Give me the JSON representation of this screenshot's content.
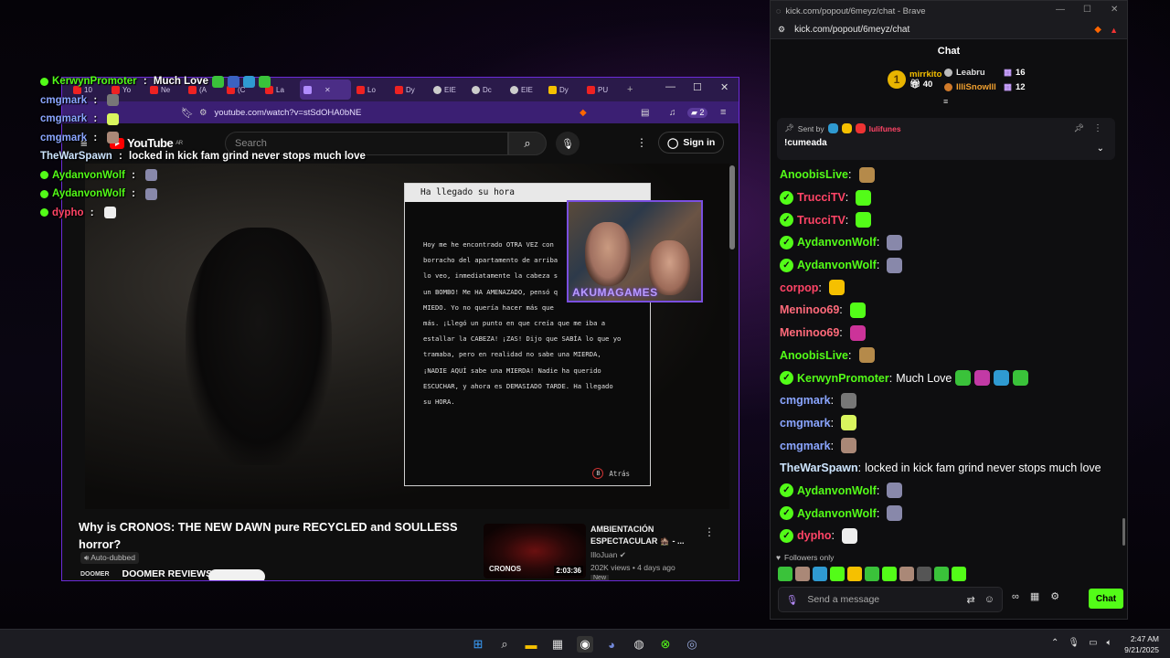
{
  "overlay_chat": [
    {
      "user": "KerwynPromoter",
      "sep": " : ",
      "text": "Much Love",
      "color": "#53fc18",
      "badge": true,
      "emotes": [
        "#3ac23a",
        "#3a62c2",
        "#2f9ad1",
        "#3ac23a"
      ]
    },
    {
      "user": "cmgmark",
      "sep": " : ",
      "text": "",
      "color": "#8aa5ff",
      "badge": false,
      "emotes": [
        "#777777"
      ]
    },
    {
      "user": "cmgmark",
      "sep": " : ",
      "text": "",
      "color": "#8aa5ff",
      "badge": false,
      "emotes": [
        "#d9f55e"
      ]
    },
    {
      "user": "cmgmark",
      "sep": " : ",
      "text": "",
      "color": "#8aa5ff",
      "badge": false,
      "emotes": [
        "#aa8877"
      ]
    },
    {
      "user": "TheWarSpawn",
      "sep": " : ",
      "text": "locked in kick fam grind never stops much love",
      "color": "#cde5ff",
      "badge": false,
      "emotes": []
    },
    {
      "user": "AydanvonWolf",
      "sep": " : ",
      "text": "",
      "color": "#53fc18",
      "badge": true,
      "emotes": [
        "#8888aa"
      ]
    },
    {
      "user": "AydanvonWolf",
      "sep": " : ",
      "text": "",
      "color": "#53fc18",
      "badge": true,
      "emotes": [
        "#8888aa"
      ]
    },
    {
      "user": "dypho",
      "sep": " : ",
      "text": "",
      "color": "#ff4466",
      "badge": true,
      "emotes": [
        "#eeeeee"
      ]
    }
  ],
  "youtube_browser": {
    "tabs": [
      {
        "label": "10",
        "fav": "red"
      },
      {
        "label": "Yo",
        "fav": "red"
      },
      {
        "label": "Ne",
        "fav": "red"
      },
      {
        "label": "(A",
        "fav": "red"
      },
      {
        "label": "(C",
        "fav": "red"
      },
      {
        "label": "La",
        "fav": "red"
      },
      {
        "label": "",
        "fav": "active"
      },
      {
        "label": "Lo",
        "fav": "red"
      },
      {
        "label": "Dy",
        "fav": "red"
      },
      {
        "label": "EIE",
        "fav": "grey"
      },
      {
        "label": "Dc",
        "fav": "grey"
      },
      {
        "label": "EIE",
        "fav": "grey"
      },
      {
        "label": "Dy",
        "fav": "yellow"
      },
      {
        "label": "PU",
        "fav": "red"
      }
    ],
    "url": "youtube.com/watch?v=stSdOHA0bNE",
    "brave_count": "2",
    "logo_text": "YouTube",
    "logo_region": "AR",
    "search_placeholder": "Search",
    "sign_in": "Sign in"
  },
  "game_note": {
    "title": "Ha llegado su hora",
    "lines": [
      "Hoy me he encontrado OTRA VEZ con",
      "borracho del apartamento de arriba",
      "lo veo, inmediatamente la cabeza s",
      "un BOMBO! Me HA AMENAZADO, pensó q",
      "MIEDO. Yo no quería hacer más que",
      "más. ¡Llegó un punto en que creía que me iba a",
      "estallar la CABEZA! ¡ZAS! Dijo que SABÍA lo que yo",
      "tramaba, pero en realidad no sabe una MIERDA,",
      "¡NADIE AQUÍ sabe una MIERDA! Nadie ha querido",
      "ESCUCHAR, y ahora es DEMASIADO TARDE. Ha llegado",
      "su HORA."
    ],
    "back_label": "Atrás",
    "back_key": "B"
  },
  "webcam": {
    "label": "AKUMAGAMES"
  },
  "video": {
    "title": "Why is CRONOS: THE NEW DAWN pure RECYCLED and SOULLESS horror?",
    "dub_label": "Auto-dubbed",
    "channel": "DOOMER REVIEWS",
    "channel_avatar_text": "DOOMER",
    "subscribe": "Subscribe"
  },
  "recommended": {
    "title": "AMBIENTACIÓN ESPECTACULAR 🏚️ - ...",
    "channel": "IlloJuan",
    "views": "202K views • 4 days ago",
    "thumb_text": "CRONOS",
    "duration": "2:03:36",
    "badge": "New"
  },
  "kick_window": {
    "window_title": "kick.com/popout/6meyz/chat - Brave",
    "url": "kick.com/popout/6meyz/chat",
    "header": "Chat",
    "leaderboard": {
      "first": {
        "rank": "1",
        "name": "mirrkito",
        "count": "40"
      },
      "second": {
        "name": "Leabru",
        "count": "16"
      },
      "third": {
        "name": "IlliSnowIll",
        "count": "12"
      }
    },
    "pinned": {
      "sent_by_label": "Sent by",
      "sender": "lulifunes",
      "message": "!cumeada"
    },
    "messages": [
      {
        "user": "AnoobisLive",
        "color": "#53fc18",
        "badge": false,
        "text": "",
        "emotes": [
          "#b58a4a"
        ]
      },
      {
        "user": "TrucciTV",
        "color": "#ff4466",
        "badge": true,
        "text": "",
        "emotes": [
          "#53fc18"
        ]
      },
      {
        "user": "TrucciTV",
        "color": "#ff4466",
        "badge": true,
        "text": "",
        "emotes": [
          "#53fc18"
        ]
      },
      {
        "user": "AydanvonWolf",
        "color": "#53fc18",
        "badge": true,
        "text": "",
        "emotes": [
          "#8888aa"
        ]
      },
      {
        "user": "AydanvonWolf",
        "color": "#53fc18",
        "badge": true,
        "text": "",
        "emotes": [
          "#8888aa"
        ]
      },
      {
        "user": "corpop",
        "color": "#ff4466",
        "badge": false,
        "text": "",
        "emotes": [
          "#f5c000"
        ]
      },
      {
        "user": "Meninoo69",
        "color": "#ff6a7a",
        "badge": false,
        "text": "",
        "emotes": [
          "#53fc18"
        ]
      },
      {
        "user": "Meninoo69",
        "color": "#ff6a7a",
        "badge": false,
        "text": "",
        "emotes": [
          "#cc3399"
        ]
      },
      {
        "user": "AnoobisLive",
        "color": "#53fc18",
        "badge": false,
        "text": "",
        "emotes": [
          "#b58a4a"
        ]
      },
      {
        "user": "KerwynPromoter",
        "color": "#53fc18",
        "badge": true,
        "text": "Much Love",
        "emotes": [
          "#3ac23a",
          "#c23aa5",
          "#2f9ad1",
          "#3ac23a"
        ]
      },
      {
        "user": "cmgmark",
        "color": "#8aa5ff",
        "badge": false,
        "text": "",
        "emotes": [
          "#777777"
        ]
      },
      {
        "user": "cmgmark",
        "color": "#8aa5ff",
        "badge": false,
        "text": "",
        "emotes": [
          "#d9f55e"
        ]
      },
      {
        "user": "cmgmark",
        "color": "#8aa5ff",
        "badge": false,
        "text": "",
        "emotes": [
          "#aa8877"
        ]
      },
      {
        "user": "TheWarSpawn",
        "color": "#cde5ff",
        "badge": false,
        "text": "locked in kick fam grind never stops much love",
        "emotes": []
      },
      {
        "user": "AydanvonWolf",
        "color": "#53fc18",
        "badge": true,
        "text": "",
        "emotes": [
          "#8888aa"
        ]
      },
      {
        "user": "AydanvonWolf",
        "color": "#53fc18",
        "badge": true,
        "text": "",
        "emotes": [
          "#8888aa"
        ]
      },
      {
        "user": "dypho",
        "color": "#ff4466",
        "badge": true,
        "text": "",
        "emotes": [
          "#eeeeee"
        ]
      }
    ],
    "followers_only": "Followers only",
    "emote_bar": [
      "#3ac23a",
      "#aa8877",
      "#2f9ad1",
      "#53fc18",
      "#f5c000",
      "#3ac23a",
      "#53fc18",
      "#aa8877",
      "#555555",
      "#3ac23a",
      "#53fc18"
    ],
    "input_placeholder": "Send a message",
    "send_button": "Chat"
  },
  "taskbar": {
    "time": "2:47 AM",
    "date": "9/21/2025"
  }
}
